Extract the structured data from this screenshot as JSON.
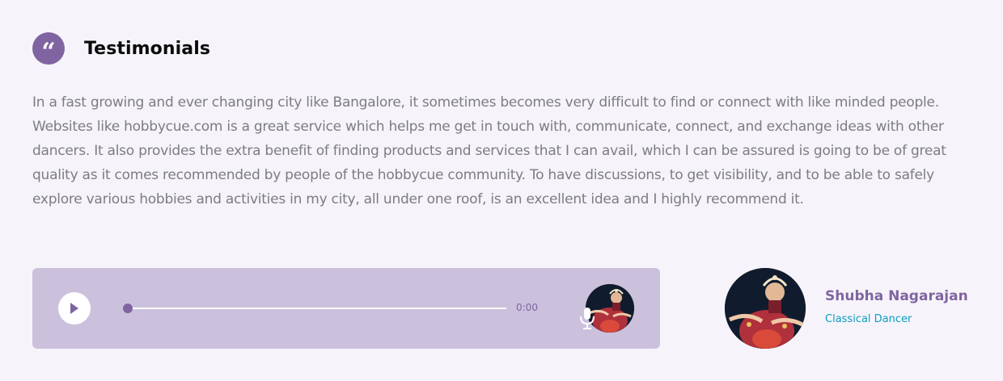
{
  "header": {
    "icon": "quote-icon",
    "quote_glyph": "“",
    "title": "Testimonials"
  },
  "testimonial": {
    "text": "In a fast growing and ever changing city like Bangalore, it sometimes becomes very difficult to find or connect with like minded people. Websites like hobbycue.com is a great service which helps me get in touch with, communicate, connect, and exchange ideas with other dancers. It also provides the extra benefit of finding products and services that I can avail, which I can be assured is going to be of great quality as it comes recommended by people of the hobbycue community. To have discussions, to get visibility, and to be able to safely explore various hobbies and activities in my city, all under one roof, is an excellent idea and I highly recommend it."
  },
  "audio_player": {
    "play_icon": "play-icon",
    "time": "0:00",
    "progress": 0,
    "mic_icon": "microphone-icon"
  },
  "author": {
    "name": "Shubha Nagarajan",
    "role": "Classical Dancer"
  },
  "colors": {
    "accent": "#8064a2",
    "player_bg": "#cbc1dd",
    "role": "#0d9cc0",
    "text": "#7c7c82"
  }
}
